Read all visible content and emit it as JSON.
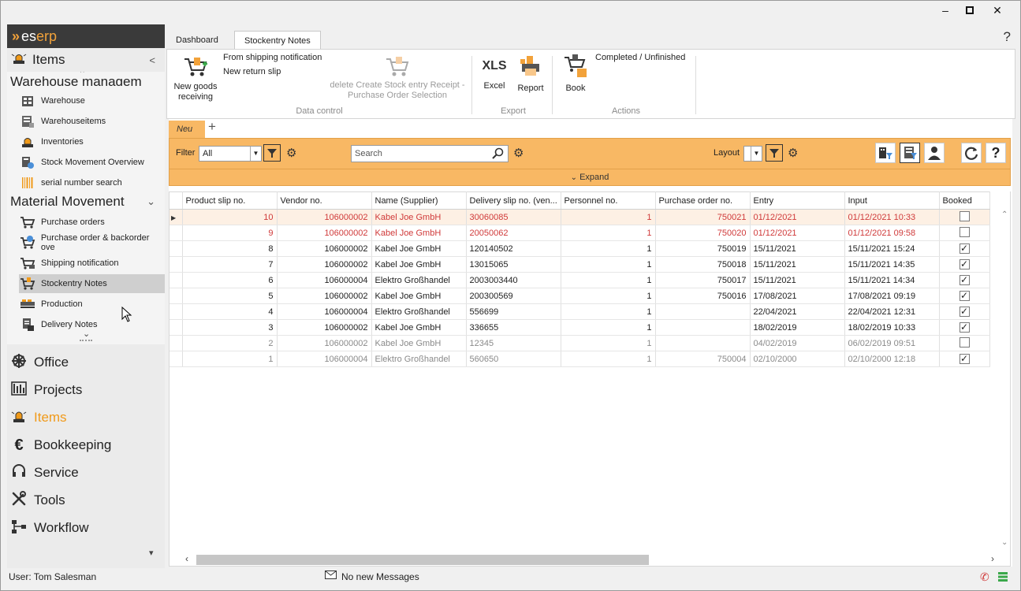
{
  "window": {
    "minimize": "🗕",
    "maximize": "🗖",
    "close": "✕"
  },
  "brand": {
    "logo_prefix": "es",
    "logo_suffix": "erp"
  },
  "sidebar": {
    "header": {
      "label": "Items"
    },
    "section_cut": "Warehouse managem",
    "warehouse_items": [
      {
        "label": "Warehouse",
        "icon": "warehouse-icon"
      },
      {
        "label": "Warehouseitems",
        "icon": "warehouse-items-icon"
      },
      {
        "label": "Inventories",
        "icon": "inventories-icon"
      },
      {
        "label": "Stock Movement Overview",
        "icon": "stock-movement-icon"
      },
      {
        "label": "serial number search",
        "icon": "barcode-icon"
      }
    ],
    "material_header": {
      "label": "Material Movement"
    },
    "material_items": [
      {
        "label": "Purchase orders",
        "icon": "cart-icon"
      },
      {
        "label": "Purchase order & backorder ove",
        "icon": "cart-alert-icon"
      },
      {
        "label": "Shipping notification",
        "icon": "cart-truck-icon"
      },
      {
        "label": "Stockentry Notes",
        "icon": "cart-in-icon",
        "selected": true
      },
      {
        "label": "Production",
        "icon": "production-icon"
      },
      {
        "label": "Delivery Notes",
        "icon": "delivery-notes-icon"
      }
    ],
    "nav": [
      {
        "label": "Office",
        "icon": "wheel-icon"
      },
      {
        "label": "Projects",
        "icon": "projects-icon"
      },
      {
        "label": "Items",
        "icon": "siren-icon",
        "active": true
      },
      {
        "label": "Bookkeeping",
        "icon": "euro-icon"
      },
      {
        "label": "Service",
        "icon": "headset-icon"
      },
      {
        "label": "Tools",
        "icon": "tools-icon"
      },
      {
        "label": "Workflow",
        "icon": "workflow-icon"
      }
    ]
  },
  "status": {
    "user": "User: Tom Salesman",
    "messages": "No new Messages"
  },
  "ribbon": {
    "tabs": [
      {
        "label": "Dashboard"
      },
      {
        "label": "Stockentry Notes",
        "active": true
      }
    ],
    "help": "?",
    "new_goods": "New goods receiving",
    "from_shipping": "From shipping notification",
    "new_return": "New return slip",
    "delete_create": "delete Create Stock entry Receipt - Purchase Order Selection",
    "group_data": "Data control",
    "xls": "XLS",
    "excel": "Excel",
    "report": "Report",
    "group_export": "Export",
    "book": "Book",
    "completed": "Completed / Unfinished",
    "group_actions": "Actions"
  },
  "view": {
    "tab_label": "Neu",
    "add_tab": "+",
    "filter_label": "Filter",
    "filter_value": "All",
    "search_placeholder": "Search",
    "layout_label": "Layout",
    "expand_label": "Expand",
    "columns": [
      "Product slip no.",
      "Vendor no.",
      "Name (Supplier)",
      "Delivery slip no. (ven...",
      "Personnel no.",
      "Purchase order no.",
      "Entry",
      "Input",
      "Booked"
    ],
    "rows": [
      {
        "slip": "10",
        "vendor": "106000002",
        "name": "Kabel Joe GmbH",
        "delivery": "30060085",
        "personnel": "1",
        "po": "750021",
        "entry": "01/12/2021",
        "input": "01/12/2021 10:33",
        "booked": false,
        "style": "red cur"
      },
      {
        "slip": "9",
        "vendor": "106000002",
        "name": "Kabel Joe GmbH",
        "delivery": "20050062",
        "personnel": "1",
        "po": "750020",
        "entry": "01/12/2021",
        "input": "01/12/2021 09:58",
        "booked": false,
        "style": "red"
      },
      {
        "slip": "8",
        "vendor": "106000002",
        "name": "Kabel Joe GmbH",
        "delivery": "120140502",
        "personnel": "1",
        "po": "750019",
        "entry": "15/11/2021",
        "input": "15/11/2021 15:24",
        "booked": true,
        "style": ""
      },
      {
        "slip": "7",
        "vendor": "106000002",
        "name": "Kabel Joe GmbH",
        "delivery": "13015065",
        "personnel": "1",
        "po": "750018",
        "entry": "15/11/2021",
        "input": "15/11/2021 14:35",
        "booked": true,
        "style": ""
      },
      {
        "slip": "6",
        "vendor": "106000004",
        "name": "Elektro Großhandel",
        "delivery": "2003003440",
        "personnel": "1",
        "po": "750017",
        "entry": "15/11/2021",
        "input": "15/11/2021 14:34",
        "booked": true,
        "style": ""
      },
      {
        "slip": "5",
        "vendor": "106000002",
        "name": "Kabel Joe GmbH",
        "delivery": "200300569",
        "personnel": "1",
        "po": "750016",
        "entry": "17/08/2021",
        "input": "17/08/2021 09:19",
        "booked": true,
        "style": ""
      },
      {
        "slip": "4",
        "vendor": "106000004",
        "name": "Elektro Großhandel",
        "delivery": "556699",
        "personnel": "1",
        "po": "",
        "entry": "22/04/2021",
        "input": "22/04/2021 12:31",
        "booked": true,
        "style": ""
      },
      {
        "slip": "3",
        "vendor": "106000002",
        "name": "Kabel Joe GmbH",
        "delivery": "336655",
        "personnel": "1",
        "po": "",
        "entry": "18/02/2019",
        "input": "18/02/2019 10:33",
        "booked": true,
        "style": ""
      },
      {
        "slip": "2",
        "vendor": "106000002",
        "name": "Kabel Joe GmbH",
        "delivery": "12345",
        "personnel": "1",
        "po": "",
        "entry": "04/02/2019",
        "input": "06/02/2019 09:51",
        "booked": false,
        "style": "grey"
      },
      {
        "slip": "1",
        "vendor": "106000004",
        "name": "Elektro Großhandel",
        "delivery": "560650",
        "personnel": "1",
        "po": "750004",
        "entry": "02/10/2000",
        "input": "02/10/2000 12:18",
        "booked": true,
        "style": "grey"
      }
    ]
  },
  "colors": {
    "accent": "#f09a1a",
    "toolbar": "#f8b864",
    "red_row": "#d03a3a"
  }
}
